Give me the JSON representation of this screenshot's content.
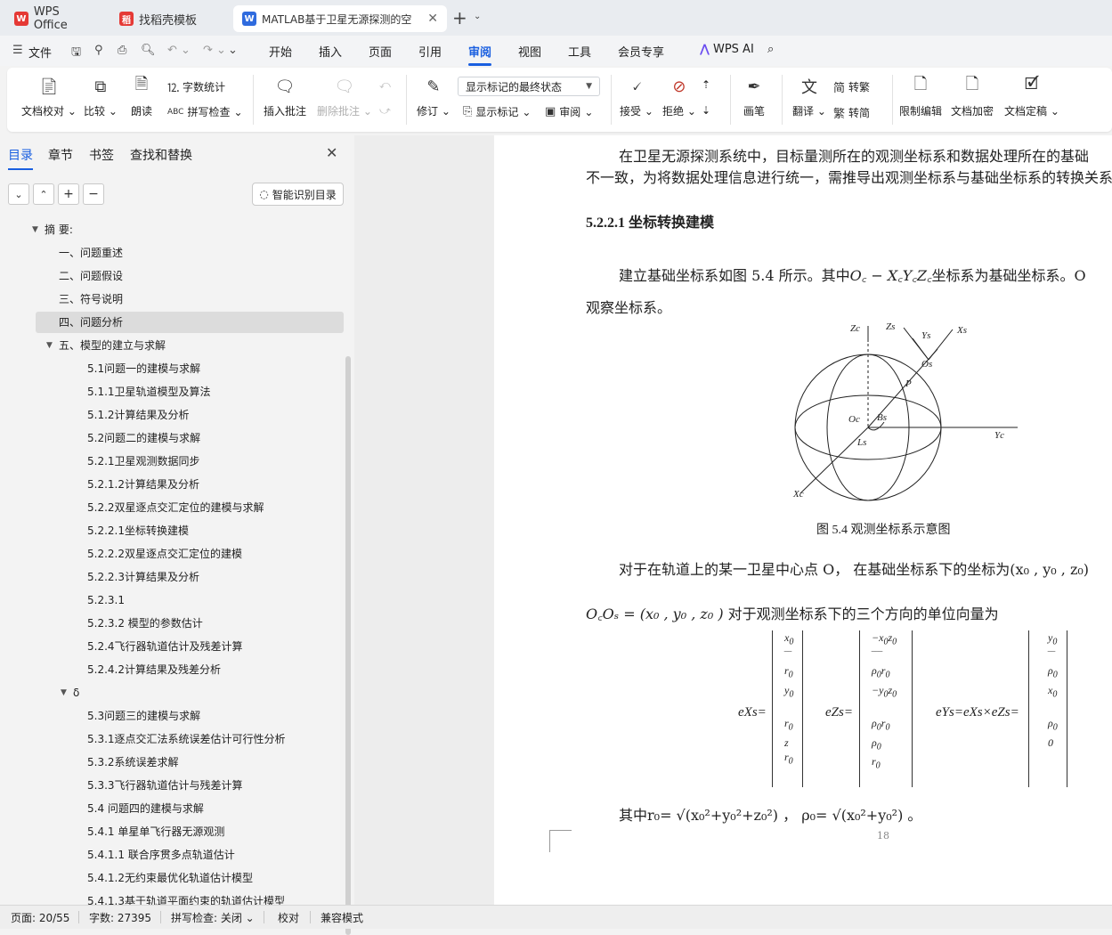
{
  "tabs": [
    {
      "label": "WPS Office"
    },
    {
      "label": "找稻壳模板"
    },
    {
      "label": "MATLAB基于卫星无源探测的空"
    }
  ],
  "menubar": {
    "file": "文件",
    "items": [
      "开始",
      "插入",
      "页面",
      "引用",
      "审阅",
      "视图",
      "工具",
      "会员专享"
    ],
    "active": "审阅",
    "ai": "WPS AI"
  },
  "ribbon": {
    "doc_proof": "文档校对",
    "compare": "比较",
    "read": "朗读",
    "word_count": "字数统计",
    "spell_check": "拼写检查",
    "insert_comment": "插入批注",
    "delete_comment": "删除批注",
    "revise": "修订",
    "markup_select": "显示标记的最终状态",
    "show_markup": "显示标记",
    "review": "审阅",
    "accept": "接受",
    "reject": "拒绝",
    "pen": "画笔",
    "translate": "翻译",
    "to_traditional": "转繁",
    "to_simplified": "转简",
    "restrict_edit": "限制编辑",
    "encrypt": "文档加密",
    "finalize": "文档定稿"
  },
  "sidebar": {
    "tabs": [
      "目录",
      "章节",
      "书签",
      "查找和替换"
    ],
    "smart_toc": "智能识别目录",
    "toc": [
      {
        "label": "摘 要:",
        "indent": 1,
        "arrow": true
      },
      {
        "label": "一、问题重述",
        "indent": 2
      },
      {
        "label": "二、问题假设",
        "indent": 2
      },
      {
        "label": "三、符号说明",
        "indent": 2
      },
      {
        "label": "四、问题分析",
        "indent": 2,
        "selected": true
      },
      {
        "label": "五、模型的建立与求解",
        "indent": 2,
        "arrow": true
      },
      {
        "label": "5.1问题一的建模与求解",
        "indent": 3
      },
      {
        "label": "5.1.1卫星轨道模型及算法",
        "indent": 3
      },
      {
        "label": "5.1.2计算结果及分析",
        "indent": 3
      },
      {
        "label": "5.2问题二的建模与求解",
        "indent": 3
      },
      {
        "label": "5.2.1卫星观测数据同步",
        "indent": 3
      },
      {
        "label": "5.2.1.2计算结果及分析",
        "indent": 3
      },
      {
        "label": "5.2.2双星逐点交汇定位的建模与求解",
        "indent": 3
      },
      {
        "label": "5.2.2.1坐标转换建模",
        "indent": 3
      },
      {
        "label": "5.2.2.2双星逐点交汇定位的建模",
        "indent": 3
      },
      {
        "label": "5.2.2.3计算结果及分析",
        "indent": 3
      },
      {
        "label": "5.2.3.1",
        "indent": 3
      },
      {
        "label": "5.2.3.2 模型的参数估计",
        "indent": 3
      },
      {
        "label": "5.2.4飞行器轨道估计及残差计算",
        "indent": 3
      },
      {
        "label": "5.2.4.2计算结果及残差分析",
        "indent": 3
      },
      {
        "label": "δ",
        "indent": 2.5,
        "arrow": true
      },
      {
        "label": "5.3问题三的建模与求解",
        "indent": 3
      },
      {
        "label": "5.3.1逐点交汇法系统误差估计可行性分析",
        "indent": 3
      },
      {
        "label": "5.3.2系统误差求解",
        "indent": 3
      },
      {
        "label": "5.3.3飞行器轨道估计与残差计算",
        "indent": 3
      },
      {
        "label": "5.4 问题四的建模与求解",
        "indent": 3
      },
      {
        "label": "5.4.1 单星单飞行器无源观测",
        "indent": 3
      },
      {
        "label": "5.4.1.1 联合序贯多点轨道估计",
        "indent": 3
      },
      {
        "label": "5.4.1.2无约束最优化轨道估计模型",
        "indent": 3
      },
      {
        "label": "5.4.1.3基于轨道平面约束的轨道估计模型",
        "indent": 3
      }
    ]
  },
  "document": {
    "para1_line1": "在卫星无源探测系统中，目标量测所在的观测坐标系和数据处理所在的基础",
    "para1_line2": "不一致，为将数据处理信息进行统一，需推导出观测坐标系与基础坐标系的转换关系",
    "heading": "5.2.2.1    坐标转换建模",
    "para2_prefix": "建立基础坐标系如图  5.4 所示。其中",
    "para2_formula": "O꜀ − X꜀Y꜀Z꜀",
    "para2_suffix": "坐标系为基础坐标系。O",
    "para2_line2": "观察坐标系。",
    "figure_caption": "图 5.4    观测坐标系示意图",
    "para3": "对于在轨道上的某一卫星中心点  O",
    "para3_b": "，  在基础坐标系下的坐标为(x₀ , y₀ , z₀)",
    "para4_formula": "O꜀Oₛ = (x₀ , y₀ , z₀ )",
    "para4_text": "对于观测坐标系下的三个方向的单位向量为",
    "para5": "其中r₀=  √(x₀²+y₀²+z₀²)  ，  ρ₀= √(x₀²+y₀²)  。",
    "page_number": "18",
    "fig_labels": {
      "zc": "Zc",
      "zs": "Zs",
      "ys": "Ys",
      "xs": "Xs",
      "os": "Os",
      "p": "P",
      "oc": "Oc",
      "bs": "Bs",
      "ls": "Ls",
      "yc": "Yc",
      "xc": "Xc"
    },
    "eq": {
      "ex": "eXs=",
      "ez": "eZs=",
      "ey": "eYs=eXs×eZs="
    }
  },
  "status": {
    "page": "页面: 20/55",
    "words": "字数: 27395",
    "spell": "拼写检查: 关闭",
    "proof": "校对",
    "compat": "兼容模式"
  },
  "colors": {
    "accent": "#1a5fe0",
    "wps_red": "#e53935"
  }
}
